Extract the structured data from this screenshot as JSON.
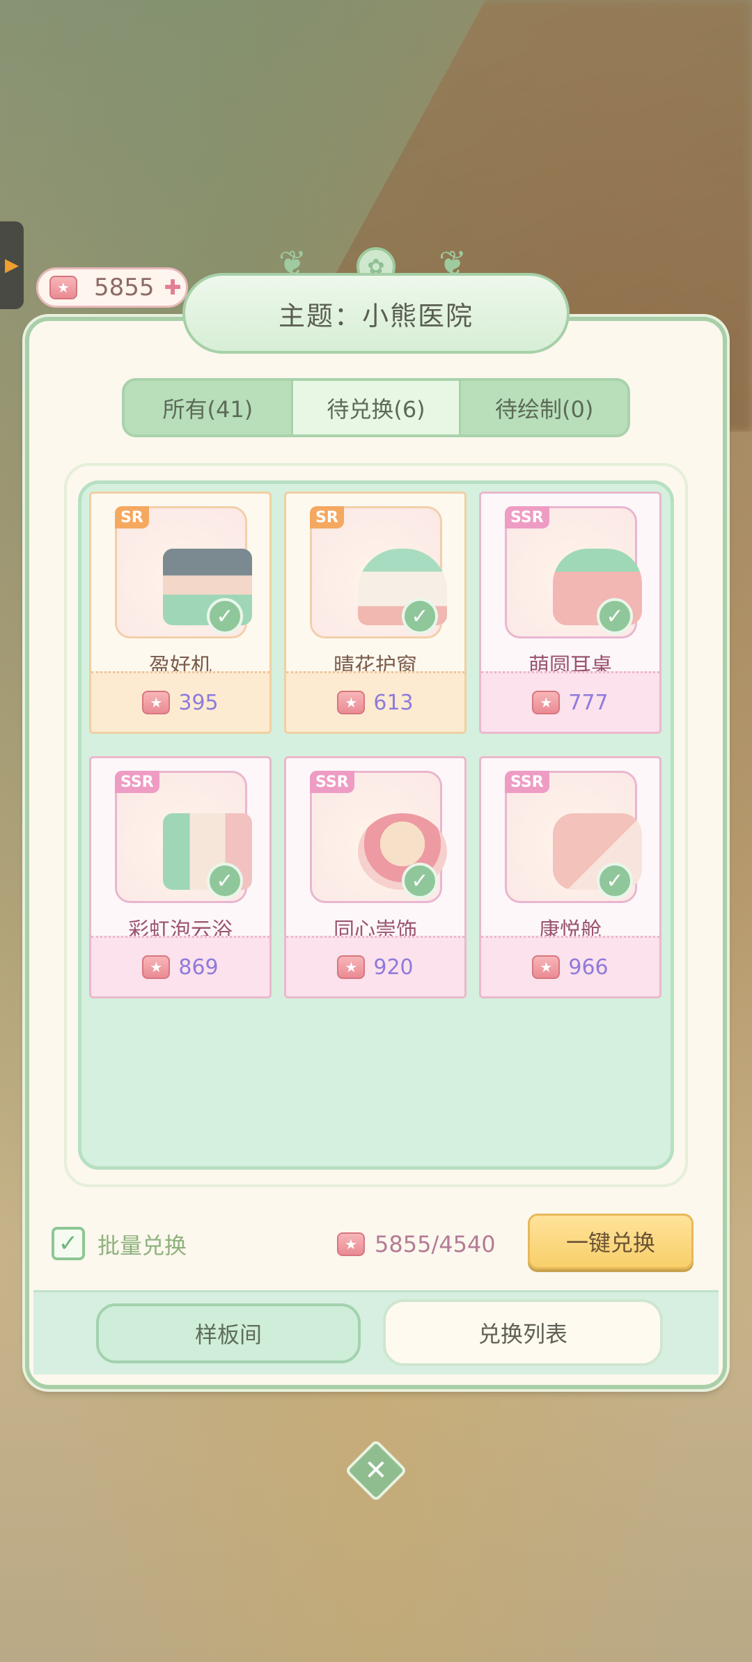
{
  "currency": {
    "amount": "5855",
    "plus": "✚"
  },
  "title": "主题：小熊医院",
  "tabs": [
    {
      "label": "所有(41)"
    },
    {
      "label": "待兑换(6)"
    },
    {
      "label": "待绘制(0)"
    }
  ],
  "items": [
    {
      "rarity": "SR",
      "name": "盈好机",
      "price": "395"
    },
    {
      "rarity": "SR",
      "name": "晴花护窗",
      "price": "613"
    },
    {
      "rarity": "SSR",
      "name": "萌圆耳桌",
      "price": "777"
    },
    {
      "rarity": "SSR",
      "name": "彩虹泡云浴",
      "price": "869"
    },
    {
      "rarity": "SSR",
      "name": "同心崇饰",
      "price": "920"
    },
    {
      "rarity": "SSR",
      "name": "康悦舱",
      "price": "966"
    }
  ],
  "footer": {
    "batch_label": "批量兑换",
    "total": "5855/4540",
    "one_key_label": "一键兑换"
  },
  "bottom_nav": {
    "sample_label": "样板间",
    "list_label": "兑换列表"
  },
  "icons": {
    "check": "✓",
    "close": "✕",
    "thumb": "👍",
    "arrow": "▶"
  },
  "colors": {
    "accent_green": "#a9cfa8",
    "price_purple": "#8f7adc",
    "button_yellow": "#f8cf6a"
  }
}
